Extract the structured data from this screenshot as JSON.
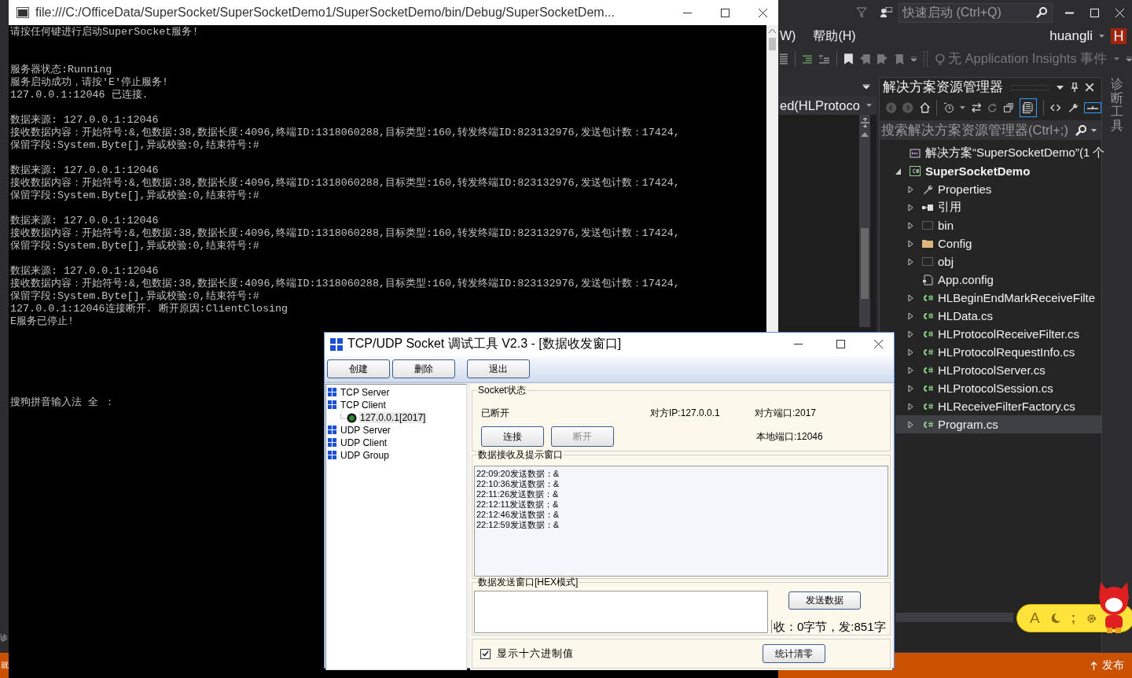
{
  "console": {
    "title": "file:///C:/OfficeData/SuperSocket/SuperSocketDemo1/SuperSocketDemo/bin/Debug/SuperSocketDem...",
    "paragraphs": [
      [
        "请按任何键进行启动SuperSocket服务!"
      ],
      [
        "服务器状态:Running",
        "服务启动成功，请按'E'停止服务!",
        "127.0.0.1:12046 已连接."
      ],
      [
        "数据来源: 127.0.0.1:12046",
        "接收数据内容：开始符号:&,包数据:38,数据长度:4096,终端ID:1318060288,目标类型:160,转发终端ID:823132976,发送包计数：17424,",
        "保留字段:System.Byte[],异或校验:0,结束符号:#"
      ],
      [
        "数据来源: 127.0.0.1:12046",
        "接收数据内容：开始符号:&,包数据:38,数据长度:4096,终端ID:1318060288,目标类型:160,转发终端ID:823132976,发送包计数：17424,",
        "保留字段:System.Byte[],异或校验:0,结束符号:#"
      ],
      [
        "数据来源: 127.0.0.1:12046",
        "接收数据内容：开始符号:&,包数据:38,数据长度:4096,终端ID:1318060288,目标类型:160,转发终端ID:823132976,发送包计数：17424,",
        "保留字段:System.Byte[],异或校验:0,结束符号:#"
      ],
      [
        "数据来源: 127.0.0.1:12046",
        "接收数据内容：开始符号:&,包数据:38,数据长度:4096,终端ID:1318060288,目标类型:160,转发终端ID:823132976,发送包计数：17424,",
        "保留字段:System.Byte[],异或校验:0,结束符号:#",
        "127.0.0.1:12046连接断开. 断开原因:ClientClosing",
        "E服务已停止!"
      ]
    ],
    "ime_status": "搜狗拼音输入法 全 ："
  },
  "vs": {
    "quick_launch": {
      "placeholder": "快速启动 (Ctrl+Q)"
    },
    "menu": [
      "W)",
      "帮助(H)"
    ],
    "user": "huangli",
    "avatar": "H",
    "insights": "无 Application Insights 事件",
    "nav_dropdown": "ed(HLProtoco",
    "side_tab": "诊断工具",
    "left_tab_text": "诊",
    "status_text": "就",
    "publish": "发布",
    "solution_explorer": {
      "title": "解决方案资源管理器",
      "search": {
        "placeholder": "搜索解决方案资源管理器(Ctrl+;)"
      },
      "tree": [
        {
          "label": "解决方案“SuperSocketDemo”(1 个",
          "kind": "solution",
          "selected": false,
          "children": [
            {
              "label": "SuperSocketDemo",
              "kind": "project",
              "expanded": true,
              "selected": false,
              "children": [
                {
                  "label": "Properties",
                  "kind": "properties",
                  "expanded": false,
                  "selected": false
                },
                {
                  "label": "引用",
                  "kind": "references",
                  "expanded": false,
                  "selected": false
                },
                {
                  "label": "bin",
                  "kind": "hidden-folder",
                  "expanded": false,
                  "selected": false
                },
                {
                  "label": "Config",
                  "kind": "folder",
                  "expanded": false,
                  "selected": false
                },
                {
                  "label": "obj",
                  "kind": "hidden-folder",
                  "expanded": false,
                  "selected": false
                },
                {
                  "label": "App.config",
                  "kind": "config",
                  "selected": false
                },
                {
                  "label": "HLBeginEndMarkReceiveFilte",
                  "kind": "csharp",
                  "expanded": false,
                  "selected": false
                },
                {
                  "label": "HLData.cs",
                  "kind": "csharp",
                  "expanded": false,
                  "selected": false
                },
                {
                  "label": "HLProtocolReceiveFilter.cs",
                  "kind": "csharp",
                  "expanded": false,
                  "selected": false
                },
                {
                  "label": "HLProtocolRequestInfo.cs",
                  "kind": "csharp",
                  "expanded": false,
                  "selected": false
                },
                {
                  "label": "HLProtocolServer.cs",
                  "kind": "csharp",
                  "expanded": false,
                  "selected": false
                },
                {
                  "label": "HLProtocolSession.cs",
                  "kind": "csharp",
                  "expanded": false,
                  "selected": false
                },
                {
                  "label": "HLReceiveFilterFactory.cs",
                  "kind": "csharp",
                  "expanded": false,
                  "selected": false
                },
                {
                  "label": "Program.cs",
                  "kind": "csharp",
                  "expanded": false,
                  "selected": true
                }
              ]
            }
          ]
        }
      ]
    },
    "ime_toolbar": {
      "mode": "A",
      "punctuation": ";"
    }
  },
  "tool": {
    "title": "TCP/UDP Socket 调试工具 V2.3 - [数据收发窗口]",
    "toolbar": [
      {
        "label": "创建"
      },
      {
        "label": "删除"
      },
      {
        "label": "退出"
      }
    ],
    "tree": [
      {
        "label": "TCP Server",
        "selected": false
      },
      {
        "label": "TCP Client",
        "selected": false,
        "children": [
          {
            "label": "127.0.0.1[2017]",
            "selected": true
          }
        ]
      },
      {
        "label": "UDP Server",
        "selected": false
      },
      {
        "label": "UDP Client",
        "selected": false
      },
      {
        "label": "UDP Group",
        "selected": false
      }
    ],
    "socket_group": {
      "title": "Socket状态",
      "status": "已断开",
      "remote_ip": "对方IP:127.0.0.1",
      "remote_port": "对方端口:2017",
      "local_port": "本地端口:12046",
      "buttons": [
        {
          "label": "连接",
          "disabled": false
        },
        {
          "label": "断开",
          "disabled": true
        }
      ]
    },
    "receive_group": {
      "title": "数据接收及提示窗口",
      "lines": [
        "22:09:20发送数据：&",
        "22:10:36发送数据：&",
        "22:11:26发送数据：&",
        "22:12:11发送数据：&",
        "22:12:46发送数据：&",
        "22:12:59发送数据：&"
      ]
    },
    "send_group": {
      "title": "数据发送窗口[HEX模式]",
      "send_button": "发送数据",
      "stats": "收：0字节，发:851字"
    },
    "hex_display": {
      "label": "显示十六进制值",
      "checked": true
    },
    "reset_button": "统计清零"
  }
}
